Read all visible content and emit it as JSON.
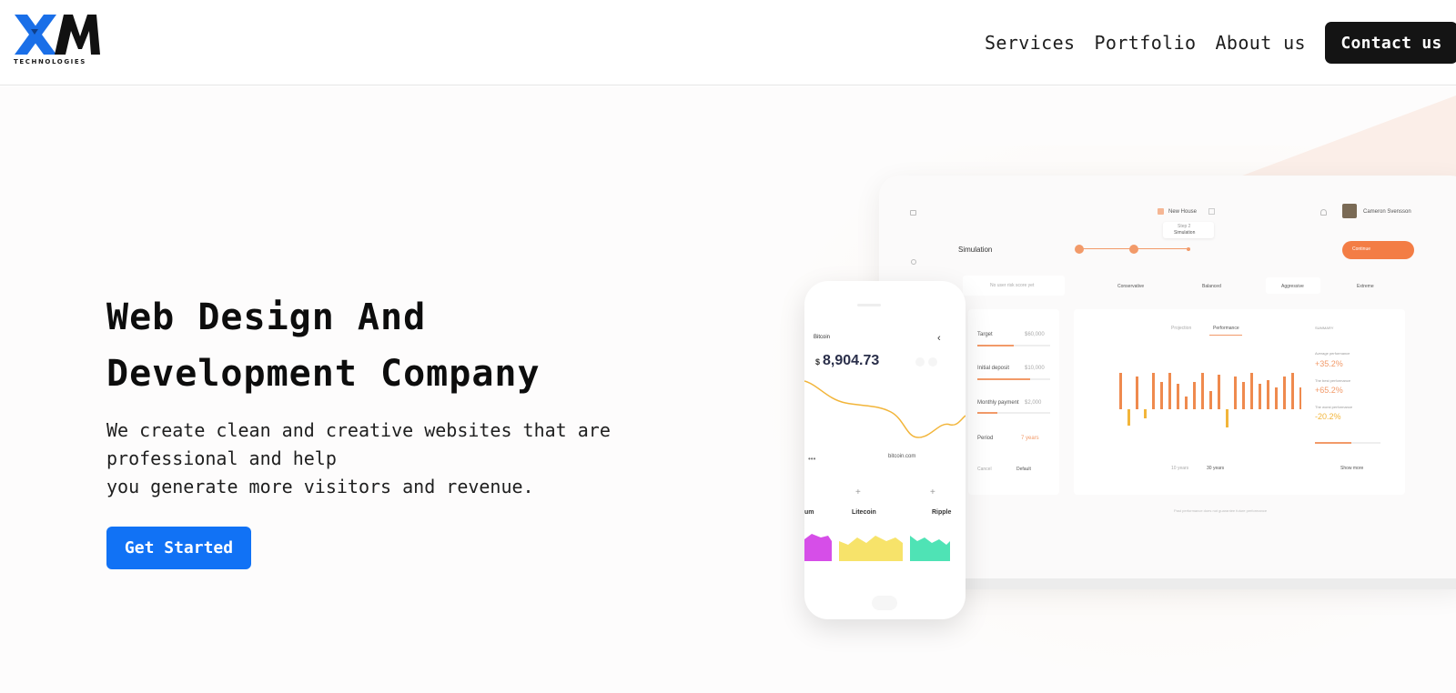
{
  "brand": {
    "logo_text": "XM",
    "logo_sub": "TECHNOLOGIES"
  },
  "nav": {
    "links": [
      "Services",
      "Portfolio",
      "About us"
    ],
    "contact": "Contact us"
  },
  "hero": {
    "title_lines": [
      "Web Design And",
      "Development Company"
    ],
    "subtitle_lines": [
      "We create clean and creative websites that are",
      "professional and help",
      "you generate more visitors and revenue."
    ],
    "cta": "Get Started"
  },
  "mockup": {
    "dashboard": {
      "top_title": "New House",
      "step": "Step 2",
      "step_name": "Simulation",
      "user": "Cameron Svensson",
      "section": "Simulation",
      "button": "Continue",
      "risk_placeholder": "No user risk score yet",
      "risk_options": [
        "Conservative",
        "Balanced",
        "Aggressive",
        "Extreme"
      ],
      "form": [
        {
          "label": "Target",
          "value": "$60,000"
        },
        {
          "label": "Initial deposit",
          "value": "$10,000"
        },
        {
          "label": "Monthly payment",
          "value": "$2,000"
        },
        {
          "label": "Period",
          "value": "7 years"
        }
      ],
      "form_buttons": [
        "Cancel",
        "Default"
      ],
      "chart_tabs": [
        "Projection",
        "Performance"
      ],
      "range_tabs": [
        "10 years",
        "30 years"
      ],
      "stats": [
        {
          "label": "Average performance",
          "value": "+35.2%"
        },
        {
          "label": "The best performance",
          "value": "+65.2%"
        },
        {
          "label": "The worst performance",
          "value": "-20.2%"
        }
      ],
      "summary_label": "SUMMARY",
      "show_more": "Show more",
      "footnote": "Past performance does not guarantee future performance"
    },
    "phone": {
      "coin": "Bitcoin",
      "price": "8,904.73",
      "currency": "$",
      "source": "bitcoin.com",
      "cards": [
        "um",
        "Litecoin",
        "Ripple"
      ]
    }
  },
  "colors": {
    "accent": "#1172f5",
    "dark": "#141414",
    "orange": "#ef8a4e",
    "amber": "#f2b53a"
  }
}
